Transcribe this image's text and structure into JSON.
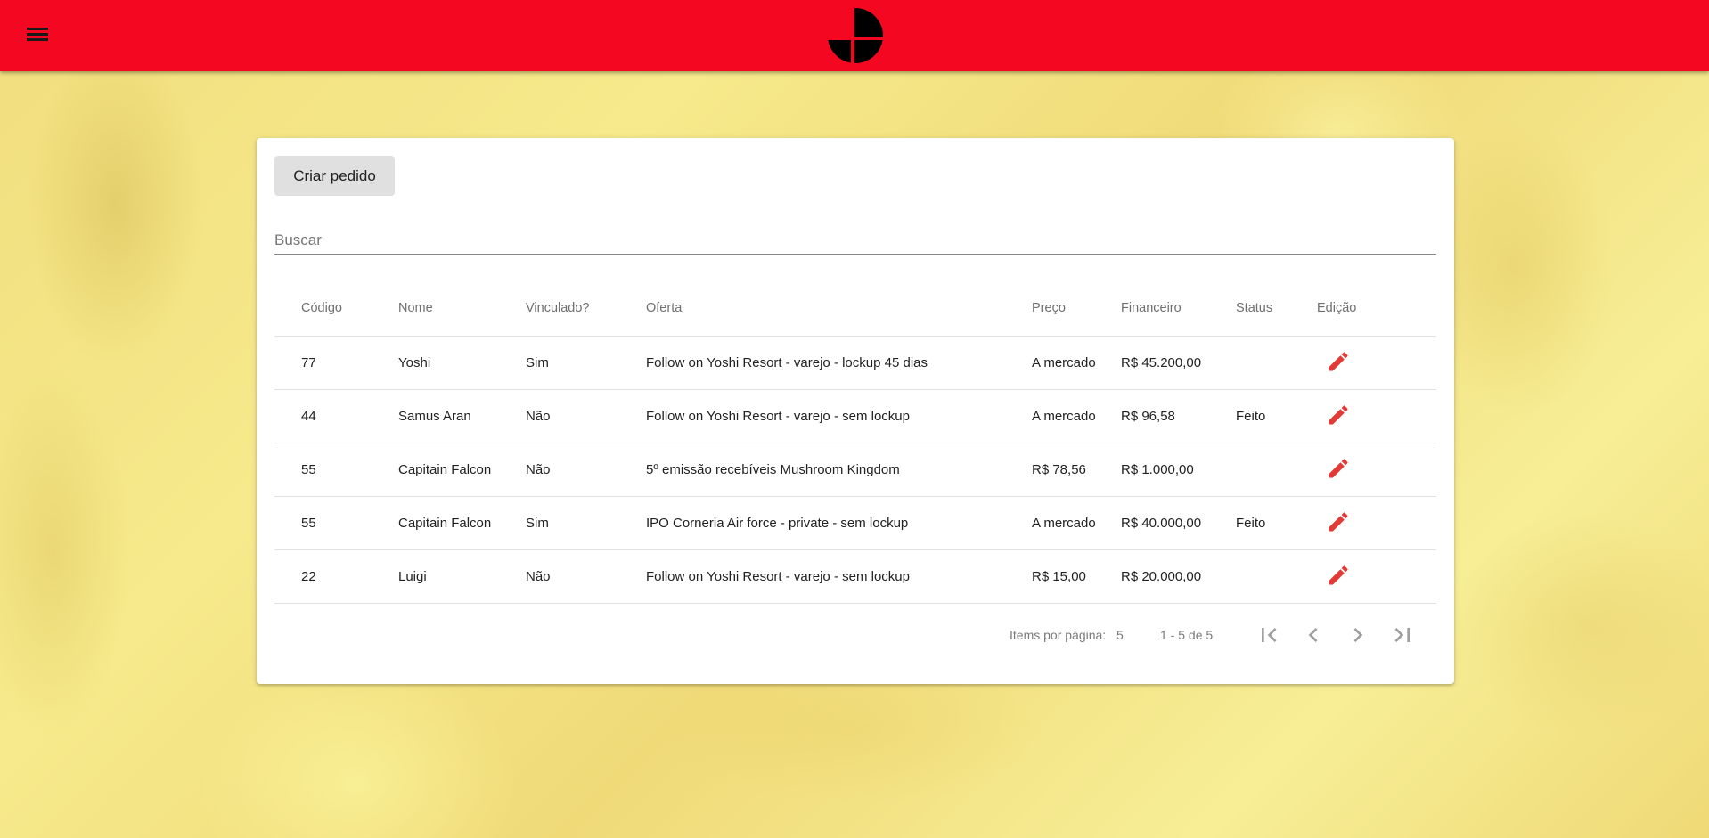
{
  "header": {
    "menu_icon": "hamburger-menu-icon",
    "logo": "smash-bros-logo",
    "bar_color": "#f40721"
  },
  "actions": {
    "create_label": "Criar pedido"
  },
  "search": {
    "placeholder": "Buscar"
  },
  "table": {
    "headers": [
      "Código",
      "Nome",
      "Vinculado?",
      "Oferta",
      "Preço",
      "Financeiro",
      "Status",
      "Edição"
    ],
    "rows": [
      [
        "77",
        "Yoshi",
        "Sim",
        "Follow on Yoshi Resort - varejo - lockup 45 dias",
        "A mercado",
        "R$ 45.200,00",
        ""
      ],
      [
        "44",
        "Samus Aran",
        "Não",
        "Follow on Yoshi Resort - varejo - sem lockup",
        "A mercado",
        "R$ 96,58",
        "Feito"
      ],
      [
        "55",
        "Capitain Falcon",
        "Não",
        "5º emissão recebíveis Mushroom Kingdom",
        "R$ 78,56",
        "R$ 1.000,00",
        ""
      ],
      [
        "55",
        "Capitain Falcon",
        "Sim",
        "IPO Corneria Air force - private - sem lockup",
        "A mercado",
        "R$ 40.000,00",
        "Feito"
      ],
      [
        "22",
        "Luigi",
        "Não",
        "Follow on Yoshi Resort - varejo - sem lockup",
        "R$ 15,00",
        "R$ 20.000,00",
        ""
      ]
    ],
    "edit_icon": "pencil-icon",
    "edit_color": "#e53935"
  },
  "paginator": {
    "label": "Items por página:",
    "page_size": "5",
    "range": "1 - 5 de 5",
    "icons": [
      "first-page-icon",
      "previous-page-icon",
      "next-page-icon",
      "last-page-icon"
    ]
  }
}
